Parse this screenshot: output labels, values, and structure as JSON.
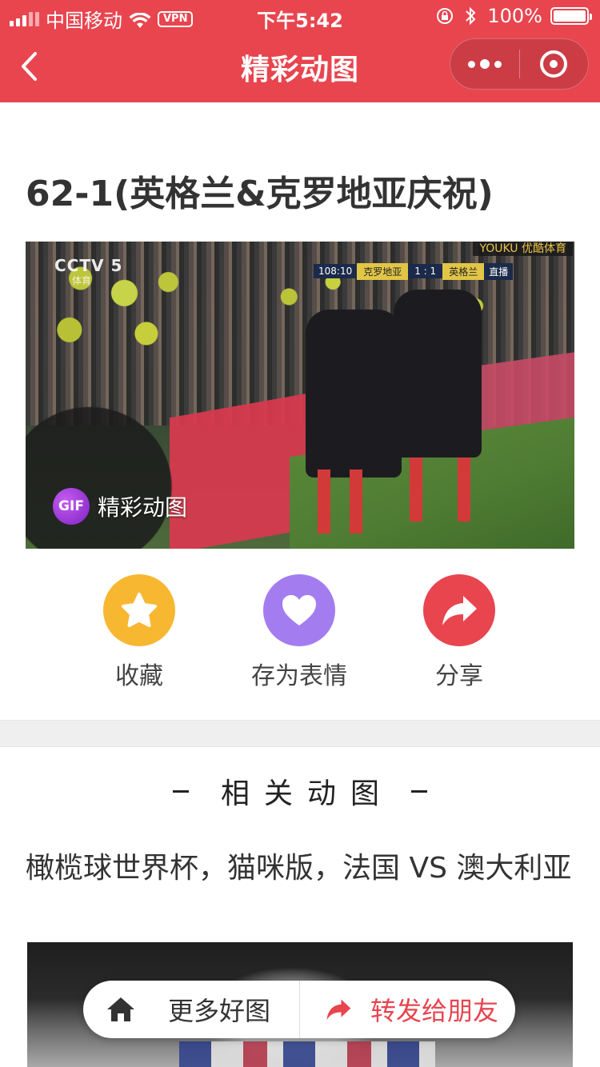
{
  "status_bar": {
    "carrier": "中国移动",
    "vpn": "VPN",
    "time": "下午5:42",
    "battery": "100%",
    "signal_bars_filled": 3,
    "signal_bars_total": 5
  },
  "nav": {
    "title": "精彩动图",
    "back_icon": "chevron-left-icon",
    "more_icon": "more-dots-icon",
    "close_icon": "target-close-icon",
    "bar_color": "#e8454f"
  },
  "article": {
    "title": "62-1(英格兰&克罗地亚庆祝)",
    "gif": {
      "channel": "CCTV 5",
      "channel_sub": "体育",
      "watermark_top": "YOUKU 优酷体育",
      "scoreboard": {
        "clock": "108:10",
        "team_a": "克罗地亚",
        "score": "1 : 1",
        "team_b": "英格兰",
        "live": "直播"
      },
      "badge_text": "GIF",
      "badge_label": "精彩动图"
    }
  },
  "actions": [
    {
      "label": "收藏",
      "icon": "star-icon",
      "color": "#f7b731"
    },
    {
      "label": "存为表情",
      "icon": "heart-icon",
      "color": "#a37df0"
    },
    {
      "label": "分享",
      "icon": "share-arrow-icon",
      "color": "#e8454f"
    }
  ],
  "related": {
    "header": "相关动图",
    "items": [
      {
        "title": "橄榄球世界杯，猫咪版，法国 VS 澳大利亚"
      }
    ]
  },
  "floatbar": {
    "home_label": "更多好图",
    "home_icon": "home-icon",
    "share_label": "转发给朋友",
    "share_icon": "forward-arrow-icon",
    "share_color": "#e8454f"
  }
}
